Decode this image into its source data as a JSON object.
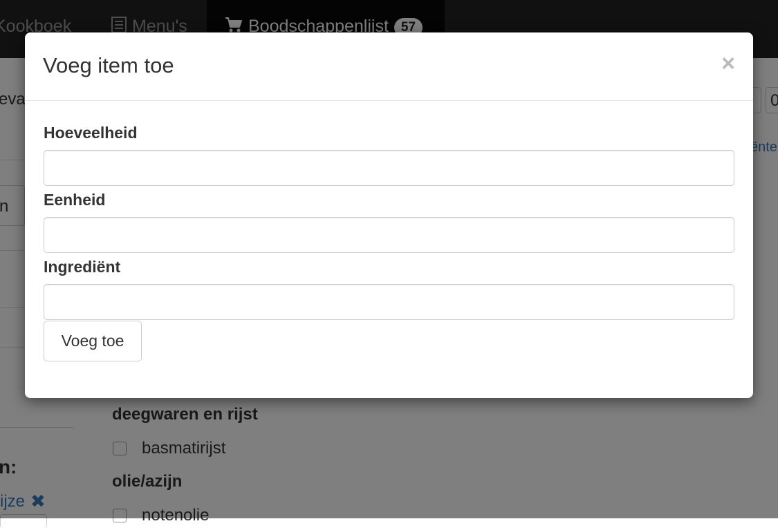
{
  "navbar": {
    "items": [
      {
        "label": "Kookboek",
        "icon": "book-icon"
      },
      {
        "label": "Menu's",
        "icon": "list-icon"
      },
      {
        "label": "Boodschappenlijst",
        "icon": "cart-icon",
        "badge": "57",
        "active": true
      }
    ]
  },
  "background": {
    "fragment_left_1": "evat",
    "fragment_left_2": "n",
    "fragment_left_3": "n:",
    "fragment_link_left": "ijze",
    "fragment_link_right": "ënte",
    "fragment_right_box": "0",
    "sections": [
      {
        "heading": "deegwaren en rijst",
        "items": [
          "basmatirijst"
        ]
      },
      {
        "heading": "olie/azijn",
        "items": [
          "notenolie"
        ]
      }
    ]
  },
  "modal": {
    "title": "Voeg item toe",
    "close_symbol": "×",
    "fields": [
      {
        "label": "Hoeveelheid",
        "value": "",
        "placeholder": ""
      },
      {
        "label": "Eenheid",
        "value": "",
        "placeholder": ""
      },
      {
        "label": "Ingrediënt",
        "value": "",
        "placeholder": ""
      }
    ],
    "submit_label": "Voeg toe"
  }
}
